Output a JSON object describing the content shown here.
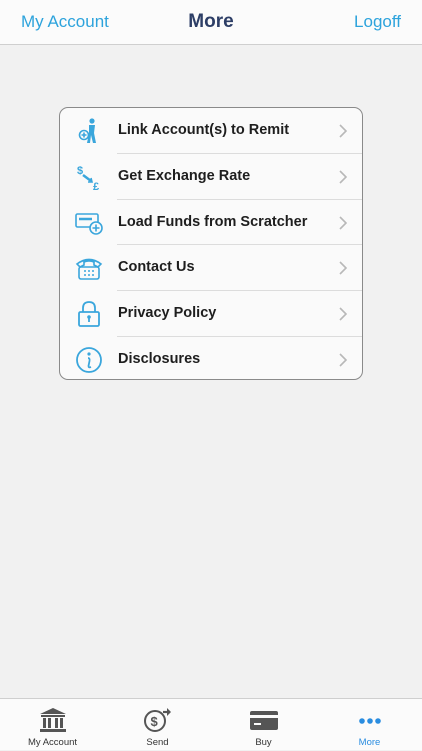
{
  "header": {
    "left_label": "My Account",
    "title": "More",
    "right_label": "Logoff"
  },
  "menu": {
    "items": [
      {
        "label": "Link Account(s) to Remit",
        "icon": "link-account-icon"
      },
      {
        "label": "Get Exchange Rate",
        "icon": "exchange-rate-icon"
      },
      {
        "label": "Load Funds from Scratcher",
        "icon": "scratcher-card-icon"
      },
      {
        "label": "Contact Us",
        "icon": "phone-icon"
      },
      {
        "label": "Privacy Policy",
        "icon": "lock-icon"
      },
      {
        "label": "Disclosures",
        "icon": "info-icon"
      }
    ]
  },
  "tabbar": {
    "tabs": [
      {
        "label": "My Account",
        "icon": "bank-icon",
        "active": false
      },
      {
        "label": "Send",
        "icon": "send-money-icon",
        "active": false
      },
      {
        "label": "Buy",
        "icon": "card-icon",
        "active": false
      },
      {
        "label": "More",
        "icon": "more-dots-icon",
        "active": true
      }
    ]
  },
  "colors": {
    "accent": "#2da3dc",
    "title": "#2d3e66",
    "active_tab": "#2a8de0",
    "icon": "#3aa6dc"
  }
}
